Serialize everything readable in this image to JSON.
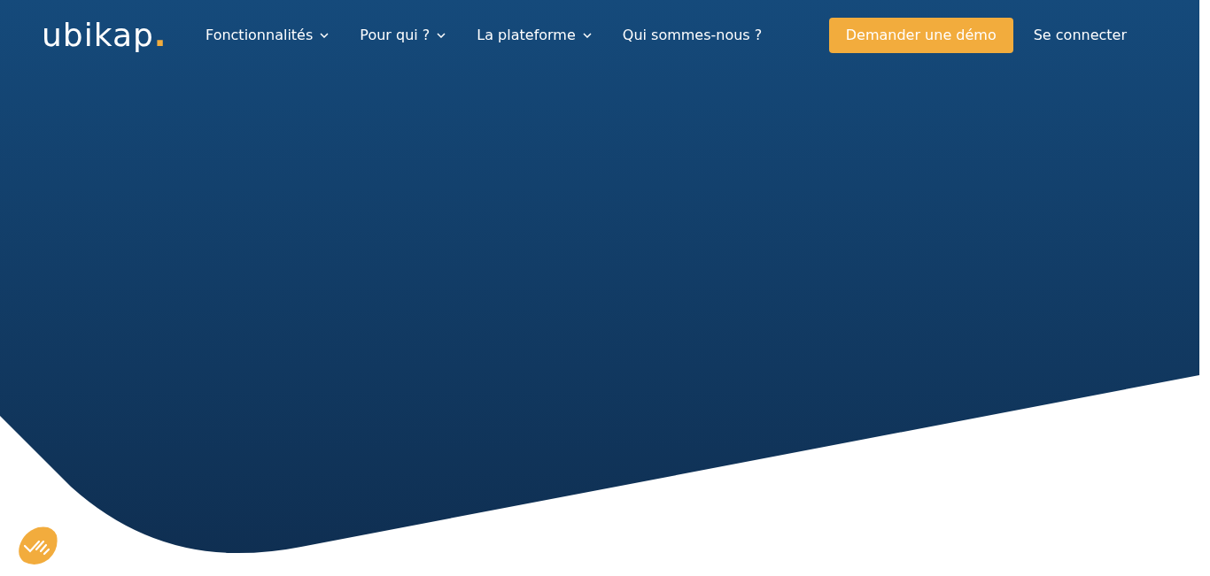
{
  "logo": {
    "text": "ubikap",
    "dot": "."
  },
  "nav": [
    {
      "label": "Fonctionnalités",
      "dropdown": true
    },
    {
      "label": "Pour qui ?",
      "dropdown": true
    },
    {
      "label": "La plateforme",
      "dropdown": true
    },
    {
      "label": "Qui sommes-nous ?",
      "dropdown": false
    }
  ],
  "cta": "Demander une démo",
  "login": "Se connecter"
}
